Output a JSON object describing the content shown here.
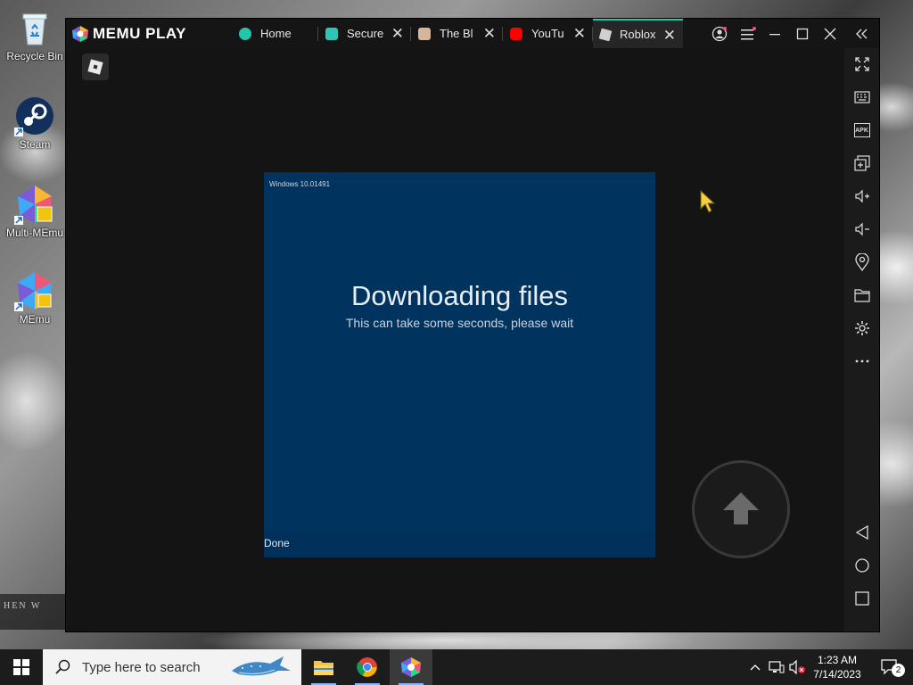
{
  "desktop": {
    "icons": [
      {
        "label": "Recycle Bin"
      },
      {
        "label": "Steam"
      },
      {
        "label": "Multi-MEmu"
      },
      {
        "label": "MEmu"
      }
    ],
    "wallpaper_text": "HEN W"
  },
  "memu": {
    "brand": "MEMU PLAY",
    "tabs": [
      {
        "label": "Home",
        "icon": "memu-home-icon",
        "color": "#22c7a9",
        "closable": false,
        "active": false
      },
      {
        "label": "Secure",
        "icon": "secure-app-icon",
        "color": "#2ec4b6",
        "closable": true,
        "active": false
      },
      {
        "label": "The Bl",
        "icon": "avatar-icon",
        "color": "#d7b59a",
        "closable": true,
        "active": false
      },
      {
        "label": "YouTu",
        "icon": "youtube-icon",
        "color": "#ff0000",
        "closable": true,
        "active": false
      },
      {
        "label": "Roblox",
        "icon": "roblox-icon",
        "color": "#d0d0d0",
        "closable": true,
        "active": true
      }
    ],
    "sidebar_tools": [
      "fullscreen-icon",
      "keyboard-mapping-icon",
      "apk-install-icon",
      "multi-instance-icon",
      "volume-up-icon",
      "volume-down-icon",
      "location-icon",
      "shared-folder-icon",
      "settings-icon",
      "more-icon",
      "back-nav-icon",
      "home-nav-icon",
      "recents-nav-icon"
    ],
    "apk_label": "APK",
    "accent_color": "#22c7a9"
  },
  "dialog": {
    "version": "Windows 10.01491",
    "title": "Downloading files",
    "subtitle": "This can take some seconds, please wait",
    "done_label": "Done",
    "background": "#00345f"
  },
  "taskbar": {
    "search_placeholder": "Type here to search",
    "time": "1:23 AM",
    "date": "7/14/2023",
    "notification_count": "2"
  }
}
